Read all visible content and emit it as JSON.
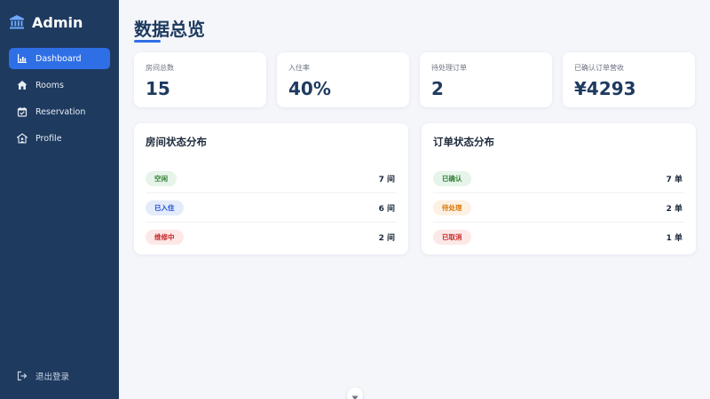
{
  "sidebar": {
    "brand": "Admin",
    "items": [
      {
        "label": "Dashboard",
        "icon": "chart-icon",
        "active": true
      },
      {
        "label": "Rooms",
        "icon": "home-icon",
        "active": false
      },
      {
        "label": "Reservation",
        "icon": "calendar-check-icon",
        "active": false
      },
      {
        "label": "Profile",
        "icon": "user-icon",
        "active": false
      }
    ],
    "logout": "退出登录"
  },
  "main": {
    "title": "数据总览",
    "stats": [
      {
        "label": "房间总数",
        "value": "15"
      },
      {
        "label": "入住率",
        "value": "40%"
      },
      {
        "label": "待处理订单",
        "value": "2"
      },
      {
        "label": "已确认订单营收",
        "value": "¥4293"
      }
    ],
    "room_panel": {
      "title": "房间状态分布",
      "rows": [
        {
          "status": "空闲",
          "count": "7 间",
          "color": "#2e7d32",
          "bg": "#e6f4ea"
        },
        {
          "status": "已入住",
          "count": "6 间",
          "color": "#1d4ed8",
          "bg": "#e4ecfb"
        },
        {
          "status": "维修中",
          "count": "2 间",
          "color": "#c62828",
          "bg": "#fde8e8"
        }
      ]
    },
    "order_panel": {
      "title": "订单状态分布",
      "rows": [
        {
          "status": "已确认",
          "count": "7 单",
          "color": "#2e7d32",
          "bg": "#e6f4ea"
        },
        {
          "status": "待处理",
          "count": "2 单",
          "color": "#d97706",
          "bg": "#fdf1e3"
        },
        {
          "status": "已取消",
          "count": "1 单",
          "color": "#c62828",
          "bg": "#fde8e8"
        }
      ]
    }
  },
  "colors": {
    "sidebar": "#1e3a5f",
    "accent": "#2f6fe6",
    "title": "#1e3a5f",
    "background": "#f4f6fa"
  }
}
